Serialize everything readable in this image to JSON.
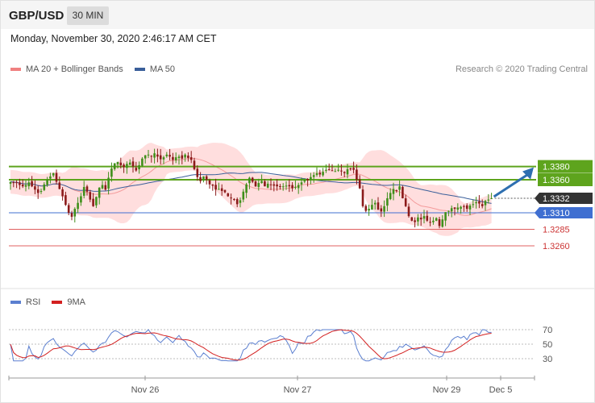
{
  "header": {
    "pair": "GBP/USD",
    "timeframe": "30 MIN"
  },
  "datetime": "Monday, November 30, 2020 2:46:17 AM CET",
  "legend": {
    "ma20": "MA 20 + Bollinger Bands",
    "ma50": "MA 50",
    "ma20_color": "#f08080",
    "ma50_color": "#3a5f9a"
  },
  "credit": "Research © 2020 Trading Central",
  "rsi_legend": {
    "rsi": "RSI",
    "ma9": "9MA",
    "rsi_color": "#5b7fd0",
    "ma9_color": "#d32020"
  },
  "colors": {
    "up_candle": "#3f8f1a",
    "down_candle": "#8b1a1a",
    "resistance": "#5ea41d",
    "support": "#3f6fd1",
    "target": "#e06060",
    "arrow": "#2e6fb0",
    "bands": "#ffd8d8"
  },
  "chart_data": [
    {
      "type": "candlestick",
      "title": "GBP/USD",
      "x_labels": [
        "Nov 26",
        "Nov 27",
        "Nov 29",
        "Dec 5"
      ],
      "ylim": [
        1.325,
        1.342
      ],
      "levels": [
        {
          "label": "1.3380",
          "value": 1.338,
          "kind": "resistance"
        },
        {
          "label": "1.3360",
          "value": 1.336,
          "kind": "resistance"
        },
        {
          "label": "1.3332",
          "value": 1.3332,
          "kind": "last_price"
        },
        {
          "label": "1.3310",
          "value": 1.331,
          "kind": "support"
        },
        {
          "label": "1.3285",
          "value": 1.3285,
          "kind": "target"
        },
        {
          "label": "1.3260",
          "value": 1.326,
          "kind": "target"
        }
      ],
      "last_price": 1.3332,
      "forecast_to": 1.338,
      "close": [
        1.3357,
        1.3356,
        1.3355,
        1.3352,
        1.335,
        1.3352,
        1.3356,
        1.335,
        1.3345,
        1.334,
        1.3343,
        1.3353,
        1.336,
        1.3365,
        1.337,
        1.3357,
        1.3346,
        1.3335,
        1.3322,
        1.331,
        1.3304,
        1.3316,
        1.3325,
        1.3335,
        1.3349,
        1.3342,
        1.333,
        1.332,
        1.3334,
        1.3348,
        1.3352,
        1.3345,
        1.3363,
        1.3377,
        1.3385,
        1.3387,
        1.3382,
        1.3379,
        1.3384,
        1.3386,
        1.338,
        1.3374,
        1.3382,
        1.3392,
        1.3397,
        1.3398,
        1.3395,
        1.34,
        1.3395,
        1.3391,
        1.3394,
        1.3398,
        1.3395,
        1.339,
        1.3394,
        1.3395,
        1.3392,
        1.3398,
        1.3393,
        1.339,
        1.3376,
        1.3364,
        1.3358,
        1.3365,
        1.336,
        1.3353,
        1.3351,
        1.3345,
        1.3346,
        1.3343,
        1.3341,
        1.3335,
        1.3332,
        1.333,
        1.3323,
        1.3329,
        1.3342,
        1.3353,
        1.3363,
        1.3357,
        1.335,
        1.3355,
        1.3358,
        1.335,
        1.3354,
        1.3352,
        1.3351,
        1.335,
        1.3349,
        1.335,
        1.3351,
        1.335,
        1.3347,
        1.3349,
        1.3352,
        1.3356,
        1.336,
        1.3359,
        1.3364,
        1.3367,
        1.337,
        1.3368,
        1.3372,
        1.3375,
        1.3375,
        1.3374,
        1.3373,
        1.3375,
        1.3373,
        1.337,
        1.3376,
        1.3377,
        1.3375,
        1.336,
        1.3347,
        1.332,
        1.3313,
        1.3316,
        1.3322,
        1.3325,
        1.3315,
        1.3312,
        1.332,
        1.3332,
        1.334,
        1.3346,
        1.3343,
        1.335,
        1.3332,
        1.332,
        1.3305,
        1.3298,
        1.3296,
        1.3303,
        1.33,
        1.3305,
        1.3298,
        1.3296,
        1.3298,
        1.3302,
        1.329,
        1.33,
        1.3311,
        1.3313,
        1.3317,
        1.3316,
        1.3318,
        1.3319,
        1.332,
        1.3316,
        1.3321,
        1.3323,
        1.3326,
        1.3324,
        1.332,
        1.3328,
        1.333,
        1.3332
      ],
      "rsi": {
        "levels": [
          70,
          50,
          30
        ],
        "ylim": [
          20,
          80
        ]
      }
    }
  ]
}
